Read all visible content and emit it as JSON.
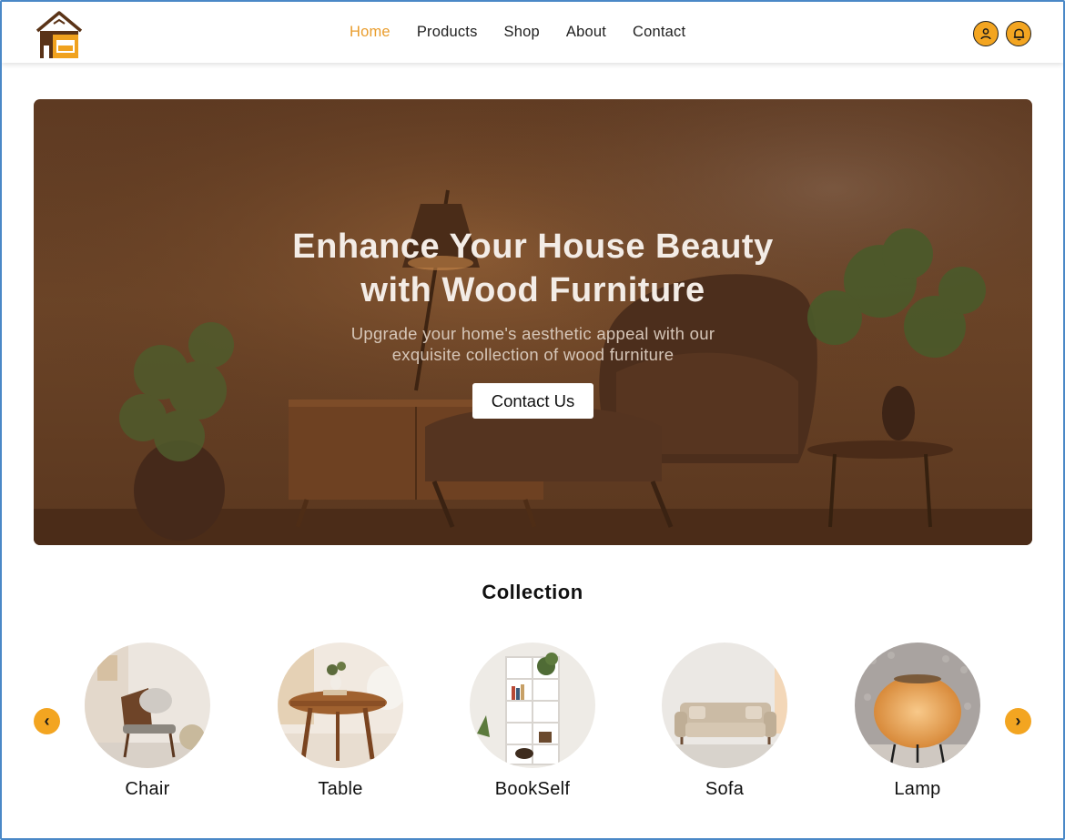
{
  "brand": {
    "logo_icon": "house-logo-icon",
    "accent": "#f3a521"
  },
  "nav": {
    "items": [
      {
        "label": "Home",
        "active": true
      },
      {
        "label": "Products",
        "active": false
      },
      {
        "label": "Shop",
        "active": false
      },
      {
        "label": "About",
        "active": false
      },
      {
        "label": "Contact",
        "active": false
      }
    ]
  },
  "header_actions": {
    "user_icon": "user-icon",
    "bell_icon": "bell-icon"
  },
  "hero": {
    "title_line1": "Enhance Your House Beauty",
    "title_line2": "with Wood Furniture",
    "subtitle_line1": "Upgrade your home's aesthetic appeal with our",
    "subtitle_line2": "exquisite collection of wood furniture",
    "cta_label": "Contact Us"
  },
  "collection": {
    "title": "Collection",
    "prev_icon": "chevron-left-icon",
    "next_icon": "chevron-right-icon",
    "items": [
      {
        "label": "Chair"
      },
      {
        "label": "Table"
      },
      {
        "label": "BookSelf"
      },
      {
        "label": "Sofa"
      },
      {
        "label": "Lamp"
      }
    ]
  }
}
